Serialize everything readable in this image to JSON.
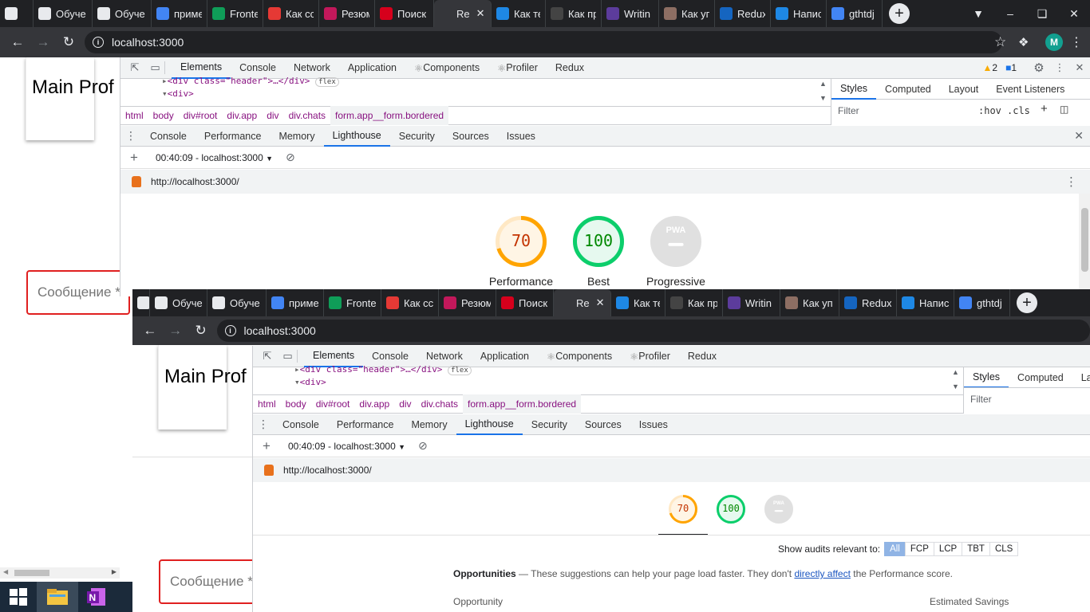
{
  "browser": {
    "tabs": [
      {
        "title": "",
        "fav": "chrome-icon",
        "color": "#e8eaed"
      },
      {
        "title": "Обуче",
        "fav": "openai-icon",
        "color": "#e8eaed"
      },
      {
        "title": "Обуче",
        "fav": "openai-icon",
        "color": "#e8eaed"
      },
      {
        "title": "приме",
        "fav": "google-icon",
        "color": "#4285f4"
      },
      {
        "title": "Fronte",
        "fav": "slides-icon",
        "color": "#0f9d58"
      },
      {
        "title": "Как сс",
        "fav": "yc-icon",
        "color": "#e53935"
      },
      {
        "title": "Резюм",
        "fav": "heart-icon",
        "color": "#c2185b"
      },
      {
        "title": "Поиск",
        "fav": "hh-icon",
        "color": "#d6001c"
      },
      {
        "title": "Re",
        "fav": "react-icon",
        "color": "#35363a",
        "active": true
      },
      {
        "title": "Как те",
        "fav": "habr-icon",
        "color": "#1e88e5"
      },
      {
        "title": "Как пр",
        "fav": "star-icon",
        "color": "#444"
      },
      {
        "title": "Writin",
        "fav": "graphql-icon",
        "color": "#5c3c9c"
      },
      {
        "title": "Как уп",
        "fav": "person-icon",
        "color": "#8d6e63"
      },
      {
        "title": "Redux",
        "fav": "cl-icon",
        "color": "#1565c0"
      },
      {
        "title": "Напис",
        "fav": "stack-icon",
        "color": "#1e88e5"
      },
      {
        "title": "gthtdj",
        "fav": "google-icon",
        "color": "#4285f4"
      }
    ],
    "url": "localhost:3000"
  },
  "page": {
    "card_text": "Main   Prof",
    "message_placeholder": "Сообщение *"
  },
  "devtools": {
    "main_tabs": [
      "Elements",
      "Console",
      "Network",
      "Application",
      "Components",
      "Profiler",
      "Redux"
    ],
    "warnings": "2",
    "messages": "1",
    "code_line1": "<div class=\"header\">…</div>",
    "code_badge": "flex",
    "code_line2": "<div>",
    "breadcrumbs": [
      "html",
      "body",
      "div#root",
      "div.app",
      "div",
      "div.chats",
      "form.app__form.bordered"
    ],
    "styles_tabs": [
      "Styles",
      "Computed",
      "Layout",
      "Event Listeners"
    ],
    "filter_placeholder": "Filter",
    "hov": ":hov",
    "cls": ".cls",
    "drawer_tabs": [
      "Console",
      "Performance",
      "Memory",
      "Lighthouse",
      "Security",
      "Sources",
      "Issues"
    ],
    "report_select": "00:40:09 - localhost:3000",
    "report_url": "http://localhost:3000/",
    "scores": [
      {
        "value": "70",
        "label": "Performance",
        "score": 0.7,
        "color": "#ffa400"
      },
      {
        "value": "100",
        "label": "Best",
        "score": 1.0,
        "color": "#0cce6b"
      },
      {
        "value": "",
        "label": "Progressive",
        "score": 0,
        "color": "#cccccc",
        "pwa": "PWA"
      }
    ],
    "audits_label": "Show audits relevant to:",
    "audit_filters": [
      "All",
      "FCP",
      "LCP",
      "TBT",
      "CLS"
    ],
    "opportunities_title": "Opportunities",
    "opportunities_dash": "—",
    "opportunities_text": "These suggestions can help your page load faster. They don't",
    "opportunities_link": "directly affect",
    "opportunities_tail": "the Performance score.",
    "col_opportunity": "Opportunity",
    "col_savings": "Estimated Savings"
  }
}
